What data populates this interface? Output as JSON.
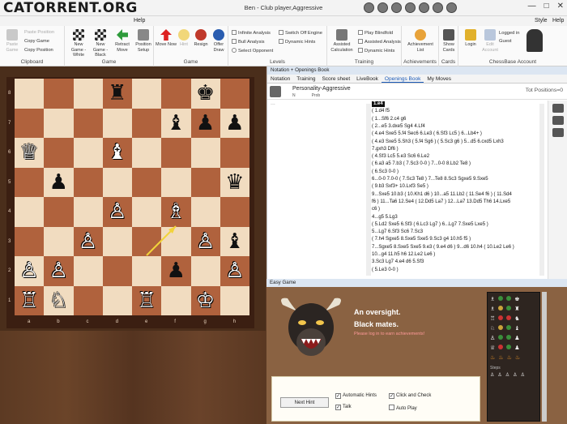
{
  "app": {
    "logo_text": "CATORRENT.ORG",
    "window_title": "Ben - Club player,Aggressive",
    "menu_help": "Help",
    "menu_style": "Style",
    "menu_help_right": "Help",
    "win_controls": [
      "—",
      "□",
      "✕"
    ]
  },
  "ribbon": {
    "clipboard": {
      "label": "Clipboard",
      "paste_game": "Paste Game",
      "paste_position": "Paste Position",
      "copy_game": "Copy Game",
      "copy_position": "Copy Position"
    },
    "game": {
      "label": "Game",
      "new_white": "New Game - White",
      "new_black": "New Game - Black",
      "retract": "Retract Move",
      "position_setup": "Position Setup"
    },
    "game2": {
      "label": "Game",
      "move_now": "Move Now",
      "hint": "Hint",
      "resign": "Resign",
      "offer_draw": "Offer Draw"
    },
    "levels": {
      "label": "Levels",
      "infinite": "Infinite Analysis",
      "switch_off": "Switch Off Engine",
      "blunder": "Bull Analysis",
      "dynamic": "Dynamic Hints",
      "select_opponent": "Select Opponent"
    },
    "training": {
      "label": "Training",
      "assisted": "Assisted Calculation",
      "play_blindfold": "Play Blindfold",
      "assisted_analysis": "Assisted Analysis",
      "dynamic_hints": "Dynamic Hints"
    },
    "achievements": {
      "label": "Achievements",
      "btn": "Achievement List"
    },
    "cards": {
      "label": "Cards",
      "btn": "Show Cards"
    },
    "account": {
      "label": "ChessBase Account",
      "login": "Login",
      "edit": "Edit Account",
      "logged_in": "Logged in",
      "user": "Guest"
    }
  },
  "board": {
    "ranks": [
      "8",
      "7",
      "6",
      "5",
      "4",
      "3",
      "2",
      "1"
    ],
    "files": [
      "a",
      "b",
      "c",
      "d",
      "e",
      "f",
      "g",
      "h"
    ],
    "pieces": [
      {
        "sq": "d8",
        "glyph": "♜",
        "color": "b"
      },
      {
        "sq": "g8",
        "glyph": "♚",
        "color": "b"
      },
      {
        "sq": "f7",
        "glyph": "♝",
        "color": "b"
      },
      {
        "sq": "g7",
        "glyph": "♟",
        "color": "b"
      },
      {
        "sq": "h7",
        "glyph": "♟",
        "color": "b"
      },
      {
        "sq": "a6",
        "glyph": "♕",
        "color": "w"
      },
      {
        "sq": "d6",
        "glyph": "♝",
        "color": "w"
      },
      {
        "sq": "b5",
        "glyph": "♟",
        "color": "b"
      },
      {
        "sq": "h5",
        "glyph": "♛",
        "color": "b"
      },
      {
        "sq": "d4",
        "glyph": "♙",
        "color": "w"
      },
      {
        "sq": "f4",
        "glyph": "♗",
        "color": "w"
      },
      {
        "sq": "c3",
        "glyph": "♙",
        "color": "w"
      },
      {
        "sq": "g3",
        "glyph": "♙",
        "color": "w"
      },
      {
        "sq": "h3",
        "glyph": "♝",
        "color": "b"
      },
      {
        "sq": "a2",
        "glyph": "♙",
        "color": "w"
      },
      {
        "sq": "b2",
        "glyph": "♙",
        "color": "w"
      },
      {
        "sq": "f2",
        "glyph": "♟",
        "color": "b"
      },
      {
        "sq": "h2",
        "glyph": "♙",
        "color": "w"
      },
      {
        "sq": "a1",
        "glyph": "♖",
        "color": "w"
      },
      {
        "sq": "b1",
        "glyph": "♘",
        "color": "w"
      },
      {
        "sq": "e1",
        "glyph": "♖",
        "color": "w"
      },
      {
        "sq": "g1",
        "glyph": "♔",
        "color": "w"
      }
    ]
  },
  "notation": {
    "panel_title": "Notation + Openings Book",
    "tabs": [
      "Notation",
      "Training",
      "Score sheet",
      "LiveBook",
      "Openings Book",
      "My Moves"
    ],
    "active_tab": "Openings Book",
    "book_name": "Personality-Aggressive",
    "col_n": "N",
    "col_prob": "Prob",
    "total_positions": "Tot Positions=0",
    "dots": "...",
    "lines": [
      "1.e4",
      "( 1.d4  f5",
      "  ( 1...Sf6  2.c4  g6",
      "    ( 2...e5  3.dxe5  Sg4  4.Lf4",
      "      ( 4.e4  Sxe5  5.f4  Sec6  6.Le3  ( 6.Sf3  Lc5 )  6...Lb4+ )",
      "      ( 4.e3  Sxe5  5.Sh3  ( 5.f4  Sg6 )  ( 5.Sc3  g6 )  5...d5  6.cxd5  Lxh3",
      "        7.gxh3  Df6 )",
      "      ( 4.Sf3  Lc5  5.e3  Sc6  6.Le2",
      "        ( 6.a3  a5  7.b3  ( 7.Sc3  0-0 )  7...0-0  8.Lb2  Te8 )",
      "        ( 6.Sc3  0-0 )",
      "        6...0-0  7.0-0  ( 7.Sc3  Te8 )  7...Te8  8.Sc3  Sgxe5  9.Sxe5",
      "        ( 9.b3  Sxf3+  10.Lxf3  Se5 )",
      "        9...Sxe5  10.b3  ( 10.Kh1  d6 )  10...a5  11.Lb2  ( 11.Se4  f6 )  ( 11.Sd4",
      "        f6 )  11...Ta6  12.Se4  ( 12.Dd5  La7 )  12...La7  13.Dd5  Th6  14.Lxe5",
      "        c6 )",
      "      4...g5  5.Lg3",
      "      ( 5.Ld2  Sxe5  6.Sf3  ( 6.Lc3  Lg7 )  6...Lg7  7.Sxe5  Lxe5 )",
      "      5...Lg7  6.Sf3  Sc6  7.Sc3",
      "      ( 7.h4  Sgxe5  8.Sxe5  Sxe5  9.Sc3  g4  10.h5  f5 )",
      "      7...Sgxe5  8.Sxe5  Sxe5  9.e3  ( 9.e4  d6 )  9...d6  10.h4  ( 10.Le2  Le6 )",
      "      10...g4  11.h5  h6  12.Le2  Le6 )",
      "    3.Sc3  Lg7  4.e4  d6  5.Sf3",
      "    ( 5.Le3  0-0 )"
    ]
  },
  "easy_game": {
    "panel_title": "Easy Game",
    "message1": "An oversight.",
    "message2": "Black mates.",
    "message3": "Please log in to earn achievements!",
    "next_hint": "Next Hint",
    "auto_hints": "Automatic Hints",
    "click_check": "Click and Check",
    "talk": "Talk",
    "auto_play": "Auto Play",
    "stats_title": "Steps"
  }
}
